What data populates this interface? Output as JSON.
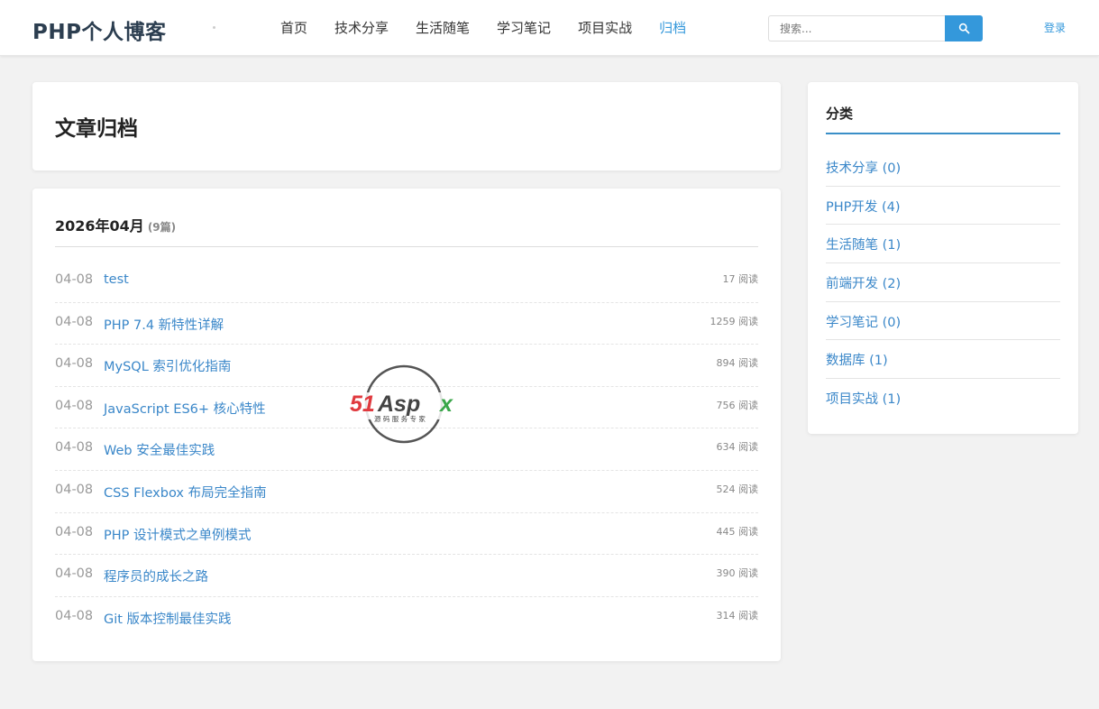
{
  "header": {
    "logo": "PHP个人博客",
    "nav": [
      {
        "label": "首页",
        "active": false
      },
      {
        "label": "技术分享",
        "active": false
      },
      {
        "label": "生活随笔",
        "active": false
      },
      {
        "label": "学习笔记",
        "active": false
      },
      {
        "label": "项目实战",
        "active": false
      },
      {
        "label": "归档",
        "active": true
      }
    ],
    "search": {
      "placeholder": "搜索...",
      "value": "",
      "icon": "search-icon"
    },
    "login_label": "登录"
  },
  "main": {
    "page_title": "文章归档",
    "month": {
      "title": "2026年04月",
      "count": "(9篇)",
      "posts": [
        {
          "date": "04-08",
          "title": "test",
          "views": "17 阅读"
        },
        {
          "date": "04-08",
          "title": "PHP 7.4 新特性详解",
          "views": "1259 阅读"
        },
        {
          "date": "04-08",
          "title": "MySQL 索引优化指南",
          "views": "894 阅读"
        },
        {
          "date": "04-08",
          "title": "JavaScript ES6+ 核心特性",
          "views": "756 阅读"
        },
        {
          "date": "04-08",
          "title": "Web 安全最佳实践",
          "views": "634 阅读"
        },
        {
          "date": "04-08",
          "title": "CSS Flexbox 布局完全指南",
          "views": "524 阅读"
        },
        {
          "date": "04-08",
          "title": "PHP 设计模式之单例模式",
          "views": "445 阅读"
        },
        {
          "date": "04-08",
          "title": "程序员的成长之路",
          "views": "390 阅读"
        },
        {
          "date": "04-08",
          "title": "Git 版本控制最佳实践",
          "views": "314 阅读"
        }
      ]
    }
  },
  "sidebar": {
    "title": "分类",
    "categories": [
      {
        "label": "技术分享 (0)"
      },
      {
        "label": "PHP开发 (4)"
      },
      {
        "label": "生活随笔 (1)"
      },
      {
        "label": "前端开发 (2)"
      },
      {
        "label": "学习笔记 (0)"
      },
      {
        "label": "数据库 (1)"
      },
      {
        "label": "项目实战 (1)"
      }
    ]
  },
  "watermark": {
    "brand": "51Aspx",
    "tagline": "源码服务专家"
  },
  "colors": {
    "accent": "#3498db",
    "link": "#3a87c9",
    "background": "#f2f2f2"
  }
}
